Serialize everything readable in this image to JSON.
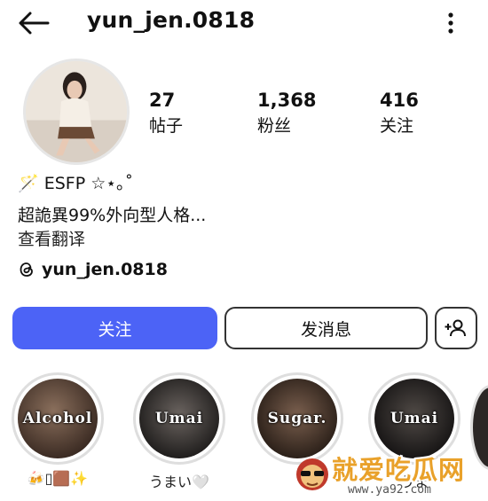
{
  "header": {
    "username": "yun_jen.0818"
  },
  "stats": [
    {
      "value": "27",
      "label": "帖子"
    },
    {
      "value": "1,368",
      "label": "粉丝"
    },
    {
      "value": "416",
      "label": "关注"
    }
  ],
  "bio": {
    "line1": "🪄 ESFP ☆⋆｡˚",
    "line2": "超詭異99%外向型人格...",
    "translate": "查看翻译"
  },
  "threads": {
    "handle": "yun_jen.0818"
  },
  "actions": {
    "follow": "关注",
    "message": "发消息"
  },
  "highlights": [
    {
      "cover_text": "Alcohol",
      "label": "🍻▯🟫✨"
    },
    {
      "cover_text": "Umai",
      "label": "うまい🤍"
    },
    {
      "cover_text": "Sugar.",
      "label": ""
    },
    {
      "cover_text": "Umai",
      "label": "うま"
    }
  ],
  "watermark": {
    "text": "就爱吃瓜网",
    "url": "www.ya92.com"
  }
}
